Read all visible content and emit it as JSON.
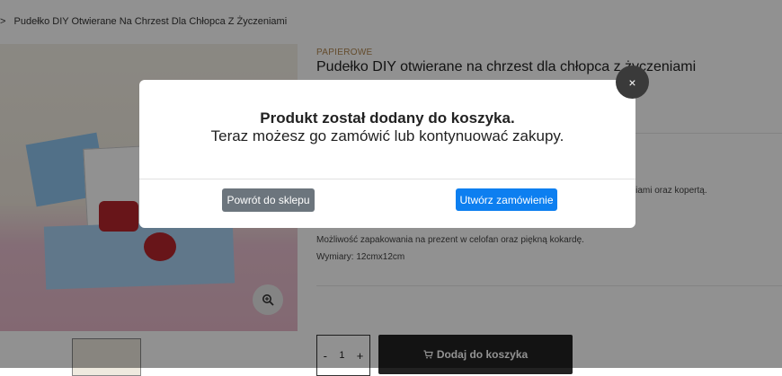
{
  "breadcrumb": {
    "separator": ">",
    "current": "Pudełko DIY Otwierane Na Chrzest Dla Chłopca Z Życzeniami"
  },
  "product": {
    "category": "PAPIEROWE",
    "title": "Pudełko DIY otwierane na chrzest dla chłopca z życzeniami",
    "desc_partial": "życzeniami oraz kopertą.",
    "desc_gift": "Możliwość zapakowania na prezent w celofan oraz piękną kokardę.",
    "desc_dimensions": "Wymiary: 12cmx12cm",
    "quantity": "1",
    "qty_minus": "-",
    "qty_plus": "+",
    "add_to_cart": "Dodaj do koszyka"
  },
  "modal": {
    "title": "Produkt został dodany do koszyka.",
    "subtitle": "Teraz możesz go zamówić lub kontynuować zakupy.",
    "back_button": "Powrót do sklepu",
    "order_button": "Utwórz zamówienie",
    "close_label": "×"
  },
  "icons": {
    "zoom": "zoom-in-icon",
    "cart": "cart-icon",
    "close": "close-icon"
  },
  "colors": {
    "order_button": "#0d7ff0",
    "back_button": "#6c757d",
    "category": "#b0864f",
    "cart_button": "#222222"
  }
}
